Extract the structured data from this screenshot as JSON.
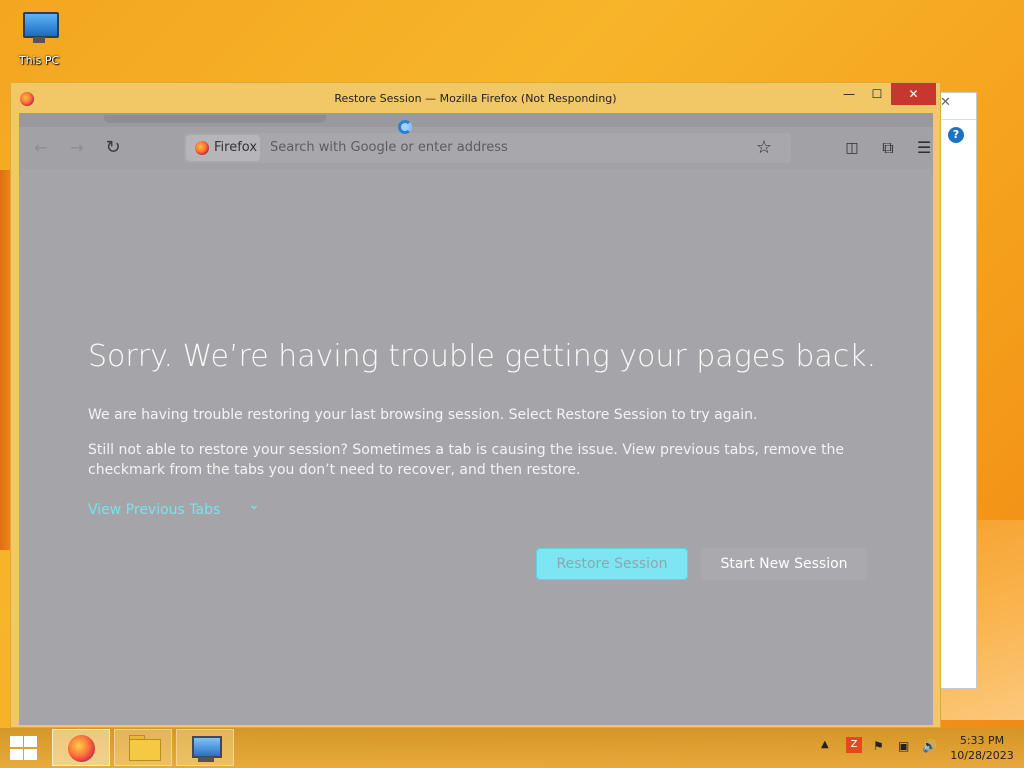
{
  "desktop": {
    "icons": [
      {
        "label": "This PC",
        "icon": "computer-icon"
      }
    ]
  },
  "window": {
    "title": "Restore Session — Mozilla Firefox (Not Responding)",
    "controls": {
      "minimize": "—",
      "maximize": "☐",
      "close": "✕"
    }
  },
  "toolbar": {
    "back": "←",
    "forward": "→",
    "reload": "↻",
    "identity_label": "Firefox",
    "url_placeholder": "Search with Google or enter address",
    "bookmark": "☆",
    "pocket": "◫",
    "extensions": "⧉",
    "menu": "☰"
  },
  "page": {
    "headline": "Sorry. We’re having trouble getting your pages back.",
    "paragraph1": "We are having trouble restoring your last browsing session. Select Restore Session to try again.",
    "paragraph2": "Still not able to restore your session? Sometimes a tab is causing the issue. View previous tabs, remove the checkmark from the tabs you don’t need to recover, and then restore.",
    "view_previous_tabs": "View Previous Tabs",
    "chevron": "⌄",
    "restore_button": "Restore Session",
    "new_session_button": "Start New Session"
  },
  "background_window": {
    "close": "✕",
    "help": "?"
  },
  "taskbar": {
    "tray_up": "▲",
    "tray_app": "Z",
    "tray_flag": "⚑",
    "tray_network": "▣",
    "tray_volume": "🔊",
    "time": "5:33 PM",
    "date": "10/28/2023"
  }
}
